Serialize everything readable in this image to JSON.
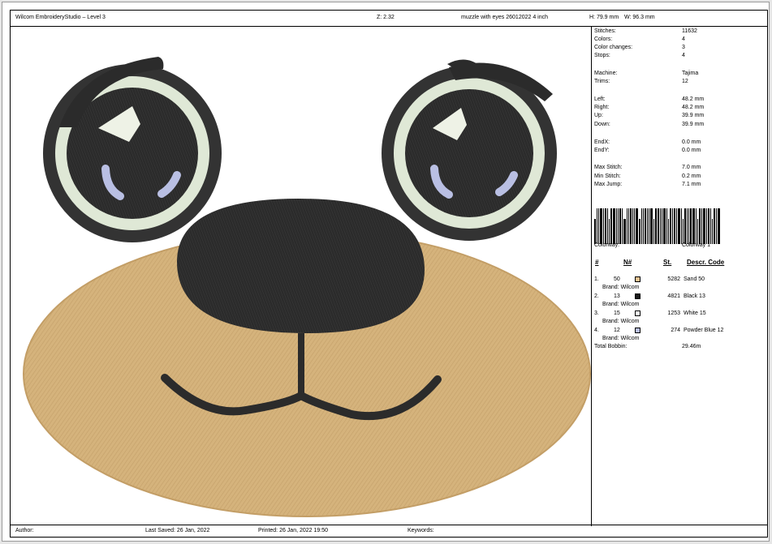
{
  "header": {
    "app": "Wilcom EmbroideryStudio – Level 3",
    "zoom": "Z: 2.32",
    "design_name": "muzzle with  eyes 26012022 4 inch",
    "height": "H: 79.9 mm",
    "width": "W: 96.3 mm"
  },
  "info": {
    "stitches": {
      "label": "Stitches:",
      "value": "11632"
    },
    "colors": {
      "label": "Colors:",
      "value": "4"
    },
    "color_changes": {
      "label": "Color changes:",
      "value": "3"
    },
    "stops": {
      "label": "Stops:",
      "value": "4"
    },
    "machine": {
      "label": "Machine:",
      "value": "Tajima"
    },
    "trims": {
      "label": "Trims:",
      "value": "12"
    },
    "left": {
      "label": "Left:",
      "value": "48.2 mm"
    },
    "right": {
      "label": "Right:",
      "value": "48.2 mm"
    },
    "up": {
      "label": "Up:",
      "value": "39.9 mm"
    },
    "down": {
      "label": "Down:",
      "value": "39.9 mm"
    },
    "endx": {
      "label": "EndX:",
      "value": "0.0 mm"
    },
    "endy": {
      "label": "EndY:",
      "value": "0.0 mm"
    },
    "max_stitch": {
      "label": "Max Stitch:",
      "value": "7.0 mm"
    },
    "min_stitch": {
      "label": "Min Stitch:",
      "value": "0.2 mm"
    },
    "max_jump": {
      "label": "Max Jump:",
      "value": "7.1 mm"
    }
  },
  "colorway": {
    "label": "Colorway:",
    "value": "Colorway 1"
  },
  "table": {
    "headers": {
      "num": "#",
      "n": "N#",
      "st": "St.",
      "desc": "Descr. Code"
    },
    "rows": [
      {
        "index": "1.",
        "n": "50",
        "color": "#e8c391",
        "stitches": "5282",
        "desc": "Sand 50",
        "brand": "Brand: Wilcom"
      },
      {
        "index": "2.",
        "n": "13",
        "color": "#1a1a1a",
        "stitches": "4821",
        "desc": "Black 13",
        "brand": "Brand: Wilcom"
      },
      {
        "index": "3.",
        "n": "15",
        "color": "#ffffff",
        "stitches": "1253",
        "desc": "White 15",
        "brand": "Brand: Wilcom"
      },
      {
        "index": "4.",
        "n": "12",
        "color": "#b9bfe3",
        "stitches": "274",
        "desc": "Powder Blue 12",
        "brand": "Brand: Wilcom"
      }
    ],
    "total_bobbin": {
      "label": "Total Bobbin:",
      "value": "29.46m"
    }
  },
  "footer": {
    "author": "Author:",
    "last_saved": "Last Saved: 26 Jan, 2022",
    "printed": "Printed: 26 Jan, 2022 19:50",
    "keywords": "Keywords:"
  },
  "design_colors": {
    "sand": "#d5b37c",
    "black": "#2b2b2b",
    "eye_ring": "#dfe8d6",
    "highlight": "#eef2e6",
    "powder_blue": "#b9bfe3"
  }
}
